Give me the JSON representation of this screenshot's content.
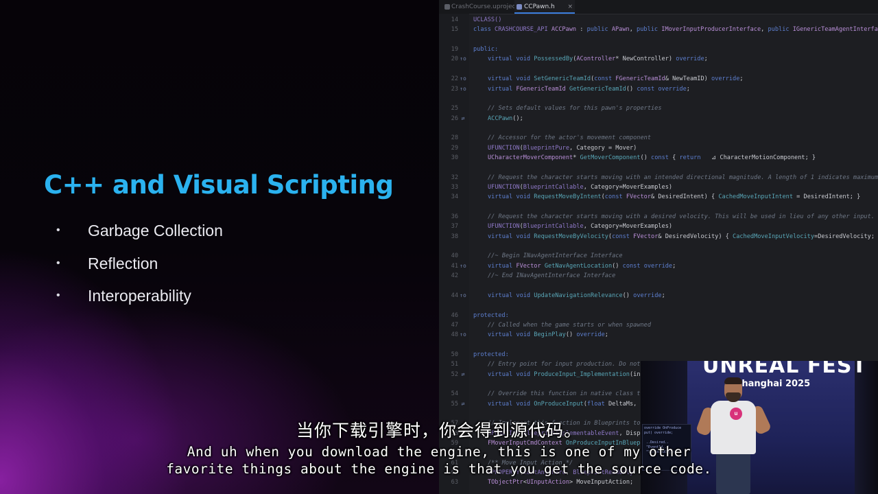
{
  "slide": {
    "title": "C++ and Visual Scripting",
    "bullet_glyph": "•",
    "bullets": [
      "Garbage Collection",
      "Reflection",
      "Interoperability"
    ]
  },
  "editor": {
    "tabs": [
      {
        "label": "CrashCourse.uproject",
        "active": false
      },
      {
        "label": "CCPawn.h",
        "active": true,
        "close": "×"
      }
    ],
    "lines": [
      {
        "n": "14",
        "g": "",
        "i": 0,
        "t": [
          [
            "mc",
            "UCLASS()"
          ]
        ]
      },
      {
        "n": "15",
        "g": "",
        "i": 0,
        "t": [
          [
            "kw",
            "class "
          ],
          [
            "mc",
            "CRASHCOURSE_API "
          ],
          [
            "ty",
            "ACCPawn"
          ],
          [
            "tx",
            " : "
          ],
          [
            "kw",
            "public "
          ],
          [
            "ty",
            "APawn"
          ],
          [
            "tx",
            ", "
          ],
          [
            "kw",
            "public "
          ],
          [
            "ty",
            "IMoverInputProducerInterface"
          ],
          [
            "tx",
            ", "
          ],
          [
            "kw",
            "public "
          ],
          [
            "ty",
            "IGenericTeamAgentInterface"
          ]
        ]
      },
      {
        "n": "",
        "g": "",
        "i": 0,
        "t": []
      },
      {
        "n": "19",
        "g": "",
        "i": 0,
        "t": [
          [
            "kw",
            "public:"
          ]
        ]
      },
      {
        "n": "20",
        "g": "↑o",
        "i": 1,
        "t": [
          [
            "kw",
            "virtual void "
          ],
          [
            "fn",
            "PossessedBy"
          ],
          [
            "tx",
            "("
          ],
          [
            "ty",
            "AController"
          ],
          [
            "tx",
            "* NewController) "
          ],
          [
            "kw",
            "override"
          ],
          [
            "tx",
            ";"
          ]
        ]
      },
      {
        "n": "",
        "g": "",
        "i": 0,
        "t": []
      },
      {
        "n": "22",
        "g": "↑o",
        "i": 1,
        "t": [
          [
            "kw",
            "virtual void "
          ],
          [
            "fn",
            "SetGenericTeamId"
          ],
          [
            "tx",
            "("
          ],
          [
            "kw",
            "const "
          ],
          [
            "ty",
            "FGenericTeamId"
          ],
          [
            "tx",
            "& NewTeamID) "
          ],
          [
            "kw",
            "override"
          ],
          [
            "tx",
            ";"
          ]
        ]
      },
      {
        "n": "23",
        "g": "↑o",
        "i": 1,
        "t": [
          [
            "kw",
            "virtual "
          ],
          [
            "ty",
            "FGenericTeamId "
          ],
          [
            "fn",
            "GetGenericTeamId"
          ],
          [
            "tx",
            "() "
          ],
          [
            "kw",
            "const override"
          ],
          [
            "tx",
            ";"
          ]
        ]
      },
      {
        "n": "",
        "g": "",
        "i": 0,
        "t": []
      },
      {
        "n": "25",
        "g": "",
        "i": 1,
        "t": [
          [
            "cm",
            "// Sets default values for this pawn's properties"
          ]
        ]
      },
      {
        "n": "26",
        "g": "⇄",
        "i": 1,
        "t": [
          [
            "fn",
            "ACCPawn"
          ],
          [
            "tx",
            "();"
          ]
        ]
      },
      {
        "n": "",
        "g": "",
        "i": 0,
        "t": []
      },
      {
        "n": "28",
        "g": "",
        "i": 1,
        "t": [
          [
            "cm",
            "// Accessor for the actor's movement component"
          ]
        ]
      },
      {
        "n": "29",
        "g": "",
        "i": 1,
        "t": [
          [
            "mc",
            "UFUNCTION"
          ],
          [
            "tx",
            "("
          ],
          [
            "mc",
            "BlueprintPure"
          ],
          [
            "tx",
            ", Category = Mover)"
          ]
        ]
      },
      {
        "n": "30",
        "g": "",
        "i": 1,
        "t": [
          [
            "ty",
            "UCharacterMoverComponent"
          ],
          [
            "tx",
            "* "
          ],
          [
            "fn",
            "GetMoverComponent"
          ],
          [
            "tx",
            "() "
          ],
          [
            "kw",
            "const"
          ],
          [
            "tx",
            " { "
          ],
          [
            "kw",
            "return "
          ],
          [
            "tx",
            "  ⊿ CharacterMotionComponent; }"
          ]
        ]
      },
      {
        "n": "",
        "g": "",
        "i": 0,
        "t": []
      },
      {
        "n": "32",
        "g": "",
        "i": 1,
        "t": [
          [
            "cm",
            "// Request the character starts moving with an intended directional magnitude. A length of 1 indicates maximum"
          ]
        ]
      },
      {
        "n": "33",
        "g": "",
        "i": 1,
        "t": [
          [
            "mc",
            "UFUNCTION"
          ],
          [
            "tx",
            "("
          ],
          [
            "mc",
            "BlueprintCallable"
          ],
          [
            "tx",
            ", Category=MoverExamples)"
          ]
        ]
      },
      {
        "n": "34",
        "g": "",
        "i": 1,
        "t": [
          [
            "kw",
            "virtual void "
          ],
          [
            "fn",
            "RequestMoveByIntent"
          ],
          [
            "tx",
            "("
          ],
          [
            "kw",
            "const "
          ],
          [
            "ty",
            "FVector"
          ],
          [
            "tx",
            "& DesiredIntent) { "
          ],
          [
            "fn",
            "CachedMoveInputIntent"
          ],
          [
            "tx",
            " = DesiredIntent; }"
          ]
        ]
      },
      {
        "n": "",
        "g": "",
        "i": 0,
        "t": []
      },
      {
        "n": "36",
        "g": "",
        "i": 1,
        "t": [
          [
            "cm",
            "// Request the character starts moving with a desired velocity. This will be used in lieu of any other input."
          ]
        ]
      },
      {
        "n": "37",
        "g": "",
        "i": 1,
        "t": [
          [
            "mc",
            "UFUNCTION"
          ],
          [
            "tx",
            "("
          ],
          [
            "mc",
            "BlueprintCallable"
          ],
          [
            "tx",
            ", Category=MoverExamples)"
          ]
        ]
      },
      {
        "n": "38",
        "g": "",
        "i": 1,
        "t": [
          [
            "kw",
            "virtual void "
          ],
          [
            "fn",
            "RequestMoveByVelocity"
          ],
          [
            "tx",
            "("
          ],
          [
            "kw",
            "const "
          ],
          [
            "ty",
            "FVector"
          ],
          [
            "tx",
            "& DesiredVelocity) { "
          ],
          [
            "fn",
            "CachedMoveInputVelocity"
          ],
          [
            "tx",
            "=DesiredVelocity;"
          ]
        ]
      },
      {
        "n": "",
        "g": "",
        "i": 0,
        "t": []
      },
      {
        "n": "40",
        "g": "",
        "i": 1,
        "t": [
          [
            "cm",
            "//~ Begin INavAgentInterface Interface"
          ]
        ]
      },
      {
        "n": "41",
        "g": "↑o",
        "i": 1,
        "t": [
          [
            "kw",
            "virtual "
          ],
          [
            "ty",
            "FVector "
          ],
          [
            "fn",
            "GetNavAgentLocation"
          ],
          [
            "tx",
            "() "
          ],
          [
            "kw",
            "const override"
          ],
          [
            "tx",
            ";"
          ]
        ]
      },
      {
        "n": "42",
        "g": "",
        "i": 1,
        "t": [
          [
            "cm",
            "//~ End INavAgentInterface Interface"
          ]
        ]
      },
      {
        "n": "",
        "g": "",
        "i": 0,
        "t": []
      },
      {
        "n": "44",
        "g": "↑o",
        "i": 1,
        "t": [
          [
            "kw",
            "virtual void "
          ],
          [
            "fn",
            "UpdateNavigationRelevance"
          ],
          [
            "tx",
            "() "
          ],
          [
            "kw",
            "override"
          ],
          [
            "tx",
            ";"
          ]
        ]
      },
      {
        "n": "",
        "g": "",
        "i": 0,
        "t": []
      },
      {
        "n": "46",
        "g": "",
        "i": 0,
        "t": [
          [
            "kw",
            "protected:"
          ]
        ]
      },
      {
        "n": "47",
        "g": "",
        "i": 1,
        "t": [
          [
            "cm",
            "// Called when the game starts or when spawned"
          ]
        ]
      },
      {
        "n": "48",
        "g": "↑o",
        "i": 1,
        "t": [
          [
            "kw",
            "virtual void "
          ],
          [
            "fn",
            "BeginPlay"
          ],
          [
            "tx",
            "() "
          ],
          [
            "kw",
            "override"
          ],
          [
            "tx",
            ";"
          ]
        ]
      },
      {
        "n": "",
        "g": "",
        "i": 0,
        "t": []
      },
      {
        "n": "50",
        "g": "",
        "i": 0,
        "t": [
          [
            "kw",
            "protected:"
          ]
        ]
      },
      {
        "n": "51",
        "g": "",
        "i": 1,
        "t": [
          [
            "cm",
            "// Entry point for input production. Do not"
          ]
        ]
      },
      {
        "n": "52",
        "g": "⇄",
        "i": 1,
        "t": [
          [
            "kw",
            "virtual void "
          ],
          [
            "fn",
            "ProduceInput_Implementation"
          ],
          [
            "tx",
            "(int"
          ]
        ]
      },
      {
        "n": "",
        "g": "",
        "i": 0,
        "t": []
      },
      {
        "n": "54",
        "g": "",
        "i": 1,
        "t": [
          [
            "cm",
            "// Override this function in native class to"
          ]
        ]
      },
      {
        "n": "55",
        "g": "⇄",
        "i": 1,
        "t": [
          [
            "kw",
            "virtual void "
          ],
          [
            "fn",
            "OnProduceInput"
          ],
          [
            "tx",
            "("
          ],
          [
            "kw",
            "float"
          ],
          [
            "tx",
            " DeltaMs, F"
          ]
        ]
      },
      {
        "n": "",
        "g": "",
        "i": 0,
        "t": []
      },
      {
        "n": "57",
        "g": "",
        "i": 1,
        "t": [
          [
            "cm",
            "// Implement this function in Blueprints to out"
          ]
        ]
      },
      {
        "n": "58",
        "g": "",
        "i": 1,
        "t": [
          [
            "mc",
            "UFUNCTION"
          ],
          [
            "tx",
            "("
          ],
          [
            "mc",
            "BlueprintImplementableEvent"
          ],
          [
            "tx",
            ", Displ"
          ]
        ]
      },
      {
        "n": "59",
        "g": "",
        "i": 1,
        "t": [
          [
            "ty",
            "FMoverInputCmdContext "
          ],
          [
            "fn",
            "OnProduceInputInBlueprint"
          ]
        ]
      },
      {
        "n": "",
        "g": "",
        "i": 0,
        "t": []
      },
      {
        "n": "61",
        "g": "",
        "i": 1,
        "t": [
          [
            "cm",
            "/** Move Input Action */"
          ]
        ]
      },
      {
        "n": "62",
        "g": "",
        "i": 1,
        "t": [
          [
            "mc",
            "UPROPERTY"
          ],
          [
            "tx",
            "("
          ],
          [
            "mc",
            "EditAnywhere"
          ],
          [
            "tx",
            ", "
          ],
          [
            "mc",
            "BlueprintReadOnly"
          ]
        ]
      },
      {
        "n": "63",
        "g": "",
        "i": 1,
        "t": [
          [
            "ty",
            "TObjectPtr"
          ],
          [
            "tx",
            "<"
          ],
          [
            "ty",
            "UInputAction"
          ],
          [
            "tx",
            "> MoveInputAction;"
          ]
        ]
      }
    ]
  },
  "video": {
    "event_title": "UNREAL FEST",
    "event_city": "Shanghai 2025",
    "badge_glyph": "u",
    "monitor_text": "override OnProduce\nput) override;\n\n ..Desired..\n \"EventId..\"\n \"SurfaceUObject\""
  },
  "subtitles": {
    "zh": "当你下载引擎时，你会得到源代码。",
    "en_line1": "And uh when you download the engine, this is one of my other",
    "en_line2": "favorite things about the engine is that you get the source code."
  },
  "colors": {
    "title_blue": "#2bb2ef",
    "editor_bg": "#1d1e22",
    "keyword": "#5d7fd0",
    "comment": "#6f7887",
    "function": "#59a7b8",
    "type": "#b98fd8",
    "macro": "#8f79c9",
    "badge_pink": "#d8327a"
  }
}
